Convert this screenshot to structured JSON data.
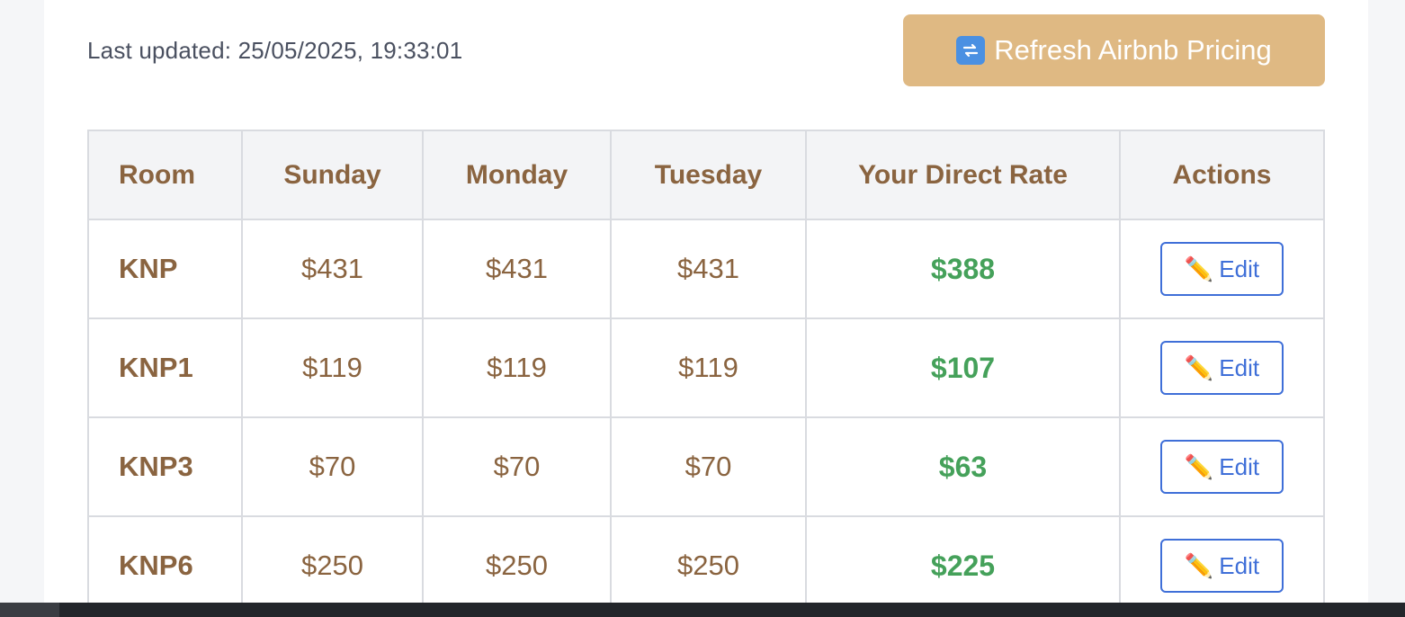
{
  "header": {
    "last_updated": "Last updated: 25/05/2025, 19:33:01",
    "refresh_label": "Refresh Airbnb Pricing",
    "refresh_icon": "arrows-cycle-icon"
  },
  "table": {
    "columns": [
      "Room",
      "Sunday",
      "Monday",
      "Tuesday",
      "Your Direct Rate",
      "Actions"
    ],
    "rows": [
      {
        "room": "KNP",
        "sunday": "$431",
        "monday": "$431",
        "tuesday": "$431",
        "direct_rate": "$388",
        "action": "Edit"
      },
      {
        "room": "KNP1",
        "sunday": "$119",
        "monday": "$119",
        "tuesday": "$119",
        "direct_rate": "$107",
        "action": "Edit"
      },
      {
        "room": "KNP3",
        "sunday": "$70",
        "monday": "$70",
        "tuesday": "$70",
        "direct_rate": "$63",
        "action": "Edit"
      },
      {
        "room": "KNP6",
        "sunday": "$250",
        "monday": "$250",
        "tuesday": "$250",
        "direct_rate": "$225",
        "action": "Edit"
      }
    ],
    "edit_icon": "pencil-icon"
  },
  "colors": {
    "accent_button": "#dfb983",
    "header_text": "#8a6440",
    "rate_text": "#45a15a",
    "edit_blue": "#3f6fd8"
  }
}
